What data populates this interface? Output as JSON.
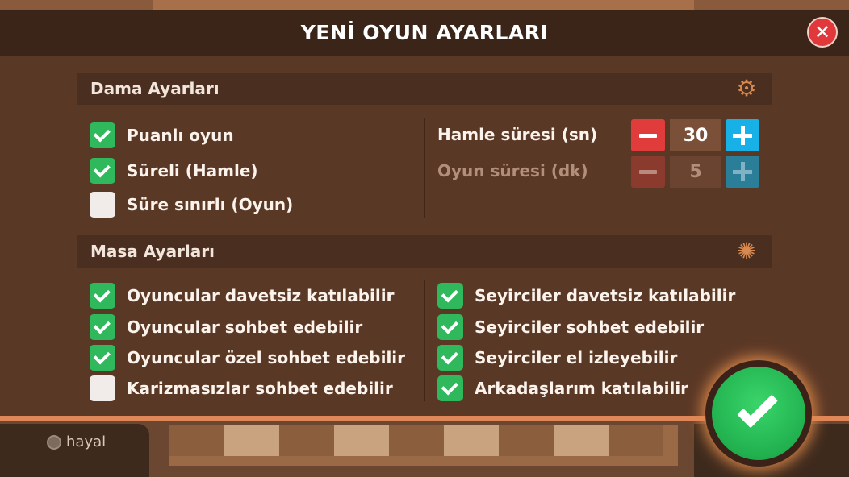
{
  "dialog": {
    "title": "YENİ OYUN AYARLARI",
    "close_label": "✕"
  },
  "dama": {
    "section_label": "Dama Ayarları",
    "section_icon": "gear-icon",
    "options": [
      {
        "label": "Puanlı oyun",
        "checked": true
      },
      {
        "label": "Süreli (Hamle)",
        "checked": true
      },
      {
        "label": "Süre sınırlı (Oyun)",
        "checked": false
      }
    ],
    "move_time": {
      "label": "Hamle süresi (sn)",
      "value": "30",
      "enabled": true
    },
    "game_time": {
      "label": "Oyun süresi (dk)",
      "value": "5",
      "enabled": false
    }
  },
  "masa": {
    "section_label": "Masa Ayarları",
    "section_icon": "table-settings-icon",
    "left_options": [
      {
        "label": "Oyuncular davetsiz katılabilir",
        "checked": true
      },
      {
        "label": "Oyuncular sohbet edebilir",
        "checked": true
      },
      {
        "label": "Oyuncular özel sohbet edebilir",
        "checked": true
      },
      {
        "label": "Karizmasızlar sohbet edebilir",
        "checked": false
      }
    ],
    "right_options": [
      {
        "label": "Seyirciler davetsiz katılabilir",
        "checked": true
      },
      {
        "label": "Seyirciler sohbet edebilir",
        "checked": true
      },
      {
        "label": "Seyirciler el izleyebilir",
        "checked": true
      },
      {
        "label": "Arkadaşlarım katılabilir",
        "checked": true
      }
    ]
  },
  "background": {
    "username": "hayal"
  },
  "colors": {
    "accent_green": "#2fb85c",
    "minus_red": "#e03c3c",
    "plus_blue": "#17b1e8",
    "panel_brown": "#5a3826",
    "header_brown": "#3b2519",
    "border_orange": "#e0875a"
  }
}
